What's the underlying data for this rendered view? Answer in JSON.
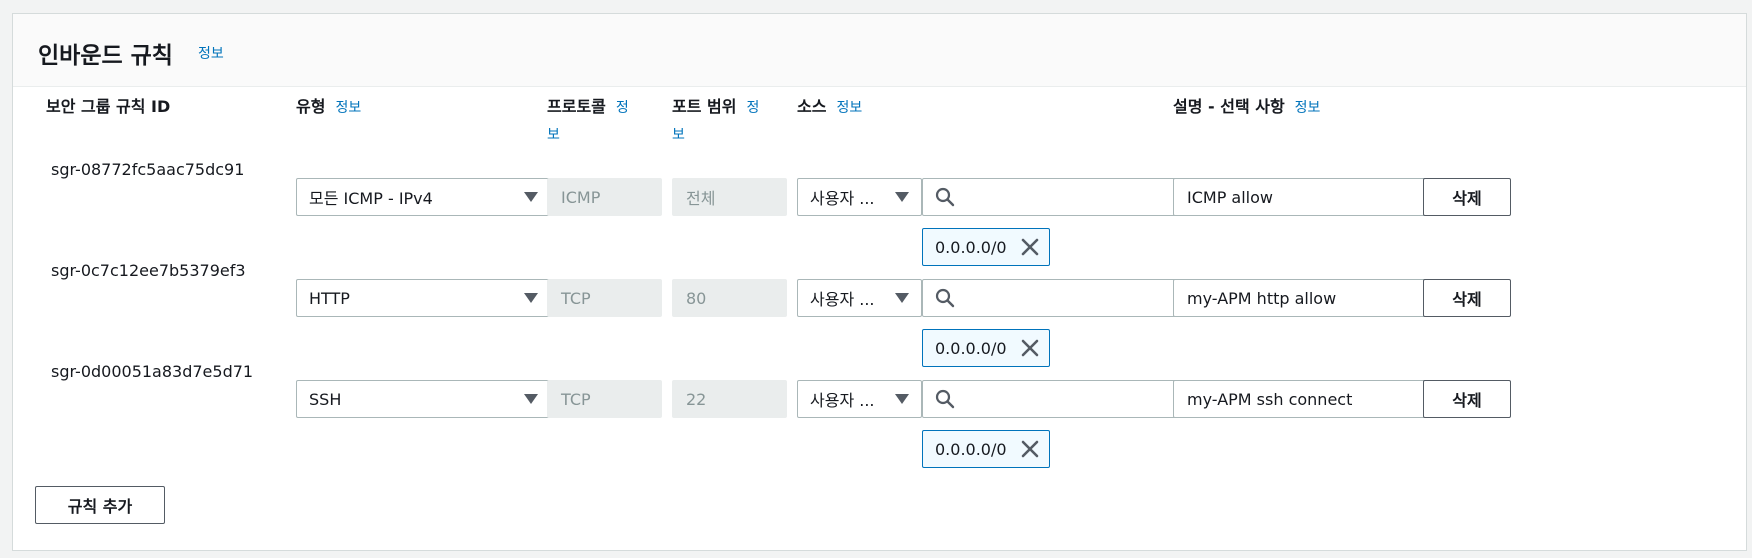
{
  "panel": {
    "title": "인바운드 규칙",
    "info": "정보"
  },
  "columns": {
    "rule_id": "보안 그룹 규칙 ID",
    "type": "유형",
    "type_info": "정보",
    "protocol_line1": "프로토콜",
    "protocol_info_a": "정",
    "protocol_info_b": "보",
    "port_line1": "포트 범위",
    "port_info_a": "정",
    "port_info_b": "보",
    "source": "소스",
    "source_info": "정보",
    "description": "설명 - 선택 사항",
    "description_info": "정보"
  },
  "rules": [
    {
      "id": "sgr-08772fc5aac75dc91",
      "type": "모든 ICMP - IPv4",
      "protocol": "ICMP",
      "port": "전체",
      "source_type": "사용자 ...",
      "search_value": "",
      "cidr": "0.0.0.0/0",
      "description": "ICMP allow",
      "delete_label": "삭제"
    },
    {
      "id": "sgr-0c7c12ee7b5379ef3",
      "type": "HTTP",
      "protocol": "TCP",
      "port": "80",
      "source_type": "사용자 ...",
      "search_value": "",
      "cidr": "0.0.0.0/0",
      "description": "my-APM http allow",
      "delete_label": "삭제"
    },
    {
      "id": "sgr-0d00051a83d7e5d71",
      "type": "SSH",
      "protocol": "TCP",
      "port": "22",
      "source_type": "사용자 ...",
      "search_value": "",
      "cidr": "0.0.0.0/0",
      "description": "my-APM ssh connect",
      "delete_label": "삭제"
    }
  ],
  "add_rule_label": "규칙 추가",
  "icons": {
    "search": "search-icon",
    "close": "close-icon",
    "dropdown": "caret-down-icon"
  },
  "colors": {
    "link": "#0073bb",
    "token_border": "#0073bb",
    "token_bg": "#f1faff"
  }
}
